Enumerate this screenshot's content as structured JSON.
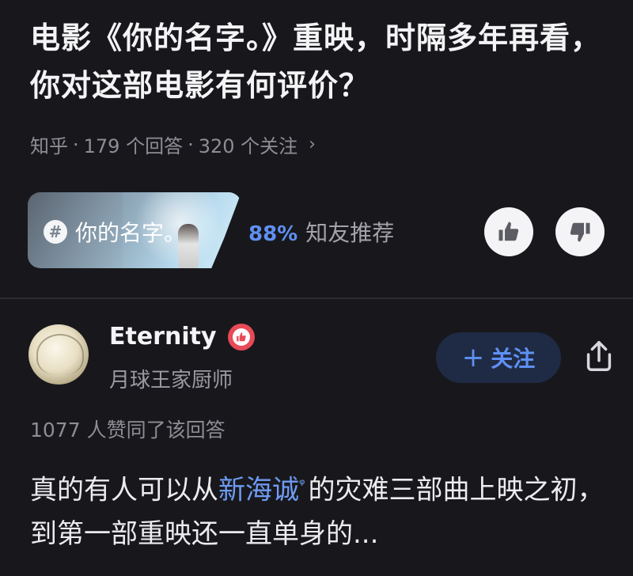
{
  "question": {
    "title": "电影《你的名字。》重映，时隔多年再看，你对这部电影有何评价？",
    "source": "知乎",
    "answers": "179 个回答",
    "follows": "320 个关注",
    "separator": "·"
  },
  "topic": {
    "label": "你的名字。",
    "recommend_pct": "88%",
    "recommend_text": "知友推荐"
  },
  "answer": {
    "author": "Eternity",
    "author_desc": "月球王家厨师",
    "follow_label": "关注",
    "likes": "1077 人赞同了该回答",
    "text_before": "真的有人可以从",
    "link_text": "新海诚",
    "text_after": "的灾难三部曲上映之初，到第一部重映还一直单身的..."
  },
  "colors": {
    "background": "#18181c",
    "accent": "#5f90f3",
    "badge": "#e84a57"
  },
  "icons": [
    "hash-icon",
    "thumbs-up-icon",
    "thumbs-down-icon",
    "plus-icon",
    "share-icon",
    "chevron-right-icon",
    "search-icon",
    "verified-badge-icon"
  ]
}
